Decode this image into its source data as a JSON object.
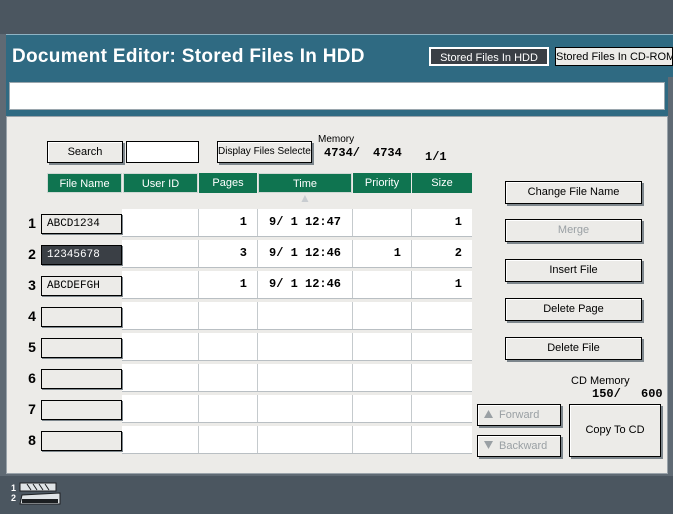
{
  "header": {
    "title": "Document Editor: Stored Files In HDD",
    "tabs": [
      {
        "label": "Stored Files In HDD",
        "active": true
      },
      {
        "label": "Stored Files In CD-ROM",
        "active": false
      }
    ]
  },
  "toolbar": {
    "search_label": "Search",
    "search_value": "",
    "display_selected_label": "Display Files Selected",
    "memory_label": "Memory",
    "memory_used": "4734/",
    "memory_total": "4734",
    "page_indicator": "1/1"
  },
  "table": {
    "columns": [
      "File Name",
      "User ID",
      "Pages",
      "Time",
      "Priority",
      "Size"
    ],
    "sort_indicator": "▲",
    "rows": [
      {
        "num": "1",
        "file_name": "ABCD1234",
        "user_id": "",
        "pages": "1",
        "time": "9/ 1 12:47",
        "priority": "",
        "size": "1",
        "selected": false
      },
      {
        "num": "2",
        "file_name": "12345678",
        "user_id": "",
        "pages": "3",
        "time": "9/ 1 12:46",
        "priority": "1",
        "size": "2",
        "selected": true
      },
      {
        "num": "3",
        "file_name": "ABCDEFGH",
        "user_id": "",
        "pages": "1",
        "time": "9/ 1 12:46",
        "priority": "",
        "size": "1",
        "selected": false
      },
      {
        "num": "4",
        "file_name": "",
        "user_id": "",
        "pages": "",
        "time": "",
        "priority": "",
        "size": "",
        "selected": false
      },
      {
        "num": "5",
        "file_name": "",
        "user_id": "",
        "pages": "",
        "time": "",
        "priority": "",
        "size": "",
        "selected": false
      },
      {
        "num": "6",
        "file_name": "",
        "user_id": "",
        "pages": "",
        "time": "",
        "priority": "",
        "size": "",
        "selected": false
      },
      {
        "num": "7",
        "file_name": "",
        "user_id": "",
        "pages": "",
        "time": "",
        "priority": "",
        "size": "",
        "selected": false
      },
      {
        "num": "8",
        "file_name": "",
        "user_id": "",
        "pages": "",
        "time": "",
        "priority": "",
        "size": "",
        "selected": false
      }
    ]
  },
  "actions": {
    "change_file_name": "Change File Name",
    "merge": "Merge",
    "insert_file": "Insert File",
    "delete_page": "Delete Page",
    "delete_file": "Delete File",
    "forward": "Forward",
    "backward": "Backward",
    "copy_to_cd": "Copy To CD"
  },
  "cd_memory": {
    "label": "CD Memory",
    "used": "150/",
    "total": "600"
  },
  "icons": {
    "forward": "up-triangle-icon",
    "backward": "down-triangle-icon",
    "tray": "paper-tray-icon"
  },
  "bottom": {
    "tray_numbers": [
      "1",
      "2"
    ]
  },
  "colors": {
    "header_bg": "#2f6a82",
    "table_header_bg": "#0f7450",
    "panel_bg": "#ecebe8",
    "frame_bg": "#5f6a74"
  }
}
